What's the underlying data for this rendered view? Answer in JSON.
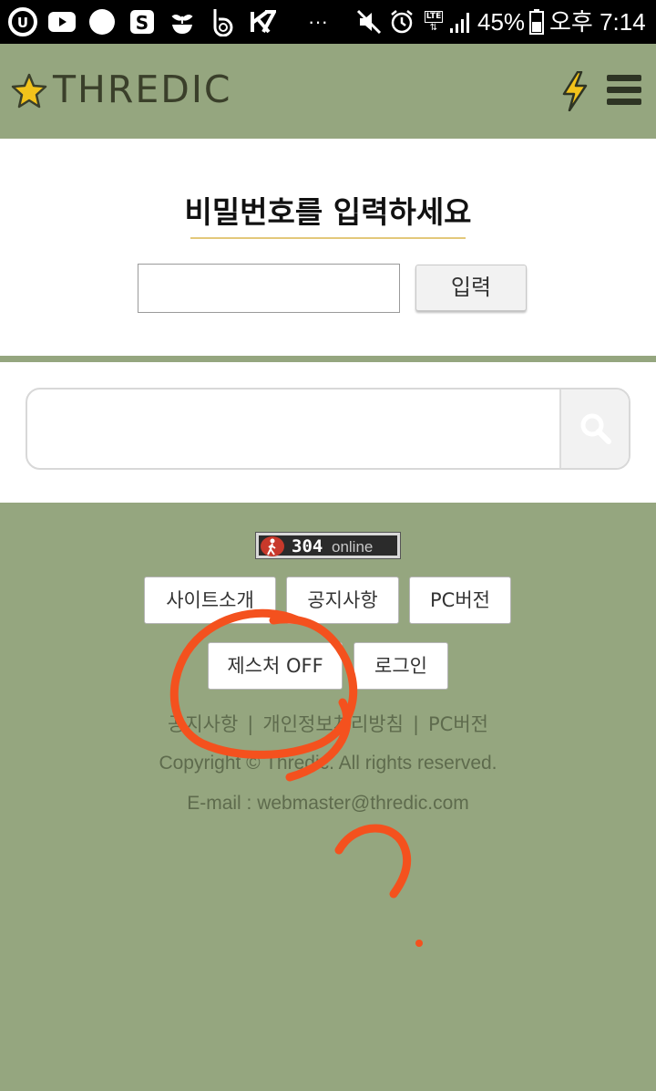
{
  "status_bar": {
    "battery": "45%",
    "time": "오후 7:14",
    "icons": [
      "uplus-icon",
      "youtube-icon",
      "circle-app-icon",
      "s-app-icon",
      "sprout-icon",
      "b-app-icon",
      "k-app-icon",
      "more-icon",
      "mute-icon",
      "alarm-icon",
      "lte-icon",
      "signal-icon",
      "battery-icon"
    ],
    "more": "···",
    "lte": "LTE"
  },
  "header": {
    "logo_text": "THREDIC",
    "logo_icon": "star-icon",
    "actions": [
      "bolt-icon",
      "menu-icon"
    ],
    "colors": {
      "bar": "#95a67f",
      "star": "#f2c31b",
      "bolt": "#f2c31b"
    }
  },
  "password": {
    "title": "비밀번호를 입력하세요",
    "input_value": "",
    "submit_label": "입력"
  },
  "search": {
    "input_value": "",
    "button_icon": "search-icon"
  },
  "footer": {
    "online_count": "304",
    "online_label": "online",
    "buttons": [
      "사이트소개",
      "공지사항",
      "PC버전",
      "제스처 OFF",
      "로그인"
    ],
    "links": [
      "공지사항",
      "개인정보처리방침",
      "PC버전"
    ],
    "link_separator": "|",
    "copyright": "Copyright © Thredic. All rights reserved.",
    "email": "E-mail : webmaster@thredic.com"
  },
  "annotation_color": "#f4511e"
}
